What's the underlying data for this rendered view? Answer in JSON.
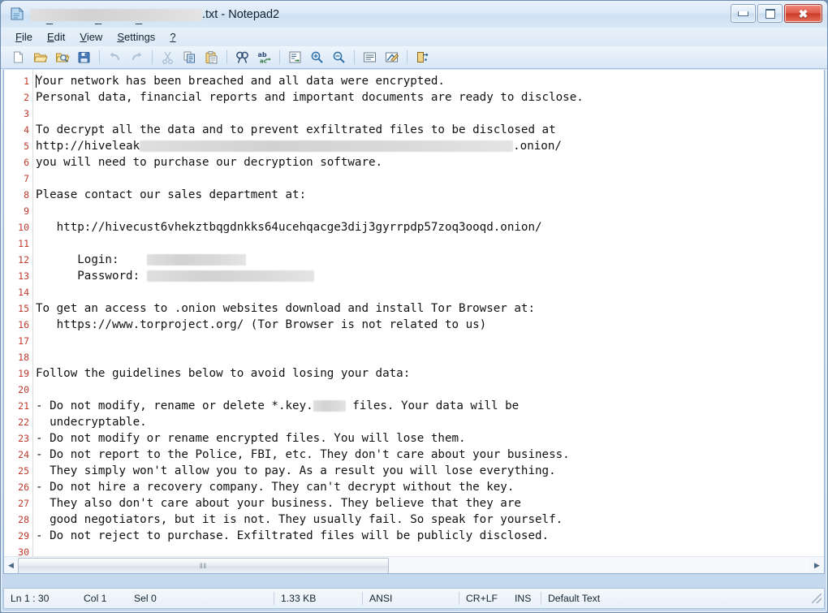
{
  "window": {
    "title_suffix": ".txt - Notepad2",
    "app_icon": "notepad-document-icon",
    "controls": {
      "minimize": "minimize-button",
      "maximize": "maximize-button",
      "close": "close-button"
    }
  },
  "menubar": {
    "items": [
      {
        "name": "file",
        "accel": "F",
        "rest": "ile"
      },
      {
        "name": "edit",
        "accel": "E",
        "rest": "dit"
      },
      {
        "name": "view",
        "accel": "V",
        "rest": "iew"
      },
      {
        "name": "settings",
        "accel": "S",
        "rest": "ettings"
      },
      {
        "name": "help",
        "accel": "?",
        "rest": ""
      }
    ]
  },
  "toolbar": {
    "buttons": [
      {
        "name": "new-file-icon",
        "enabled": true
      },
      {
        "name": "open-file-icon",
        "enabled": true
      },
      {
        "name": "open-recent-icon",
        "enabled": true
      },
      {
        "name": "save-file-icon",
        "enabled": true
      },
      {
        "name": "undo-icon",
        "enabled": false
      },
      {
        "name": "redo-icon",
        "enabled": false
      },
      {
        "name": "cut-icon",
        "enabled": false
      },
      {
        "name": "copy-icon",
        "enabled": true
      },
      {
        "name": "paste-icon",
        "enabled": true
      },
      {
        "name": "find-icon",
        "enabled": true
      },
      {
        "name": "replace-icon",
        "enabled": true
      },
      {
        "name": "goto-line-icon",
        "enabled": true
      },
      {
        "name": "zoom-in-icon",
        "enabled": true
      },
      {
        "name": "zoom-out-icon",
        "enabled": true
      },
      {
        "name": "word-wrap-icon",
        "enabled": true
      },
      {
        "name": "scheme-settings-icon",
        "enabled": true
      },
      {
        "name": "exit-icon",
        "enabled": true
      }
    ]
  },
  "editor": {
    "total_lines": 30,
    "lines": [
      {
        "n": 1,
        "text": "Your network has been breached and all data were encrypted."
      },
      {
        "n": 2,
        "text": "Personal data, financial reports and important documents are ready to disclose."
      },
      {
        "n": 3,
        "text": ""
      },
      {
        "n": 4,
        "text": "To decrypt all the data and to prevent exfiltrated files to be disclosed at"
      },
      {
        "n": 5,
        "text": "http://hiveleak",
        "redact_after": 460,
        "text_after": ".onion/"
      },
      {
        "n": 6,
        "text": "you will need to purchase our decryption software."
      },
      {
        "n": 7,
        "text": ""
      },
      {
        "n": 8,
        "text": "Please contact our sales department at:"
      },
      {
        "n": 9,
        "text": ""
      },
      {
        "n": 10,
        "text": "   http://hivecust6vhekztbqgdnkks64ucehqacge3dij3gyrrpdp57zoq3ooqd.onion/"
      },
      {
        "n": 11,
        "text": ""
      },
      {
        "n": 12,
        "text": "      Login:    ",
        "redact_after": 122
      },
      {
        "n": 13,
        "text": "      Password: ",
        "redact_after": 206
      },
      {
        "n": 14,
        "text": ""
      },
      {
        "n": 15,
        "text": "To get an access to .onion websites download and install Tor Browser at:"
      },
      {
        "n": 16,
        "text": "   https://www.torproject.org/ (Tor Browser is not related to us)"
      },
      {
        "n": 17,
        "text": ""
      },
      {
        "n": 18,
        "text": ""
      },
      {
        "n": 19,
        "text": "Follow the guidelines below to avoid losing your data:"
      },
      {
        "n": 20,
        "text": ""
      },
      {
        "n": 21,
        "text": "- Do not modify, rename or delete *.key.",
        "redact_after": 40,
        "text_after": " files. Your data will be"
      },
      {
        "n": 22,
        "text": "  undecryptable."
      },
      {
        "n": 23,
        "text": "- Do not modify or rename encrypted files. You will lose them."
      },
      {
        "n": 24,
        "text": "- Do not report to the Police, FBI, etc. They don't care about your business."
      },
      {
        "n": 25,
        "text": "  They simply won't allow you to pay. As a result you will lose everything."
      },
      {
        "n": 26,
        "text": "- Do not hire a recovery company. They can't decrypt without the key."
      },
      {
        "n": 27,
        "text": "  They also don't care about your business. They believe that they are"
      },
      {
        "n": 28,
        "text": "  good negotiators, but it is not. They usually fail. So speak for yourself."
      },
      {
        "n": 29,
        "text": "- Do not reject to purchase. Exfiltrated files will be publicly disclosed."
      },
      {
        "n": 30,
        "text": ""
      }
    ]
  },
  "scrollbar": {
    "left_arrow": "◀",
    "right_arrow": "▶",
    "grip": "‖‖"
  },
  "statusbar": {
    "line": "Ln 1 : 30",
    "column": "Col 1",
    "selection": "Sel 0",
    "filesize": "1.33 KB",
    "encoding": "ANSI",
    "line_endings": "CR+LF",
    "insert_mode": "INS",
    "scheme": "Default Text"
  },
  "colors": {
    "line_number": "#c0392b",
    "close_button": "#c93a27",
    "frame": "#6f8cb0",
    "editor_bg": "#ffffff"
  }
}
